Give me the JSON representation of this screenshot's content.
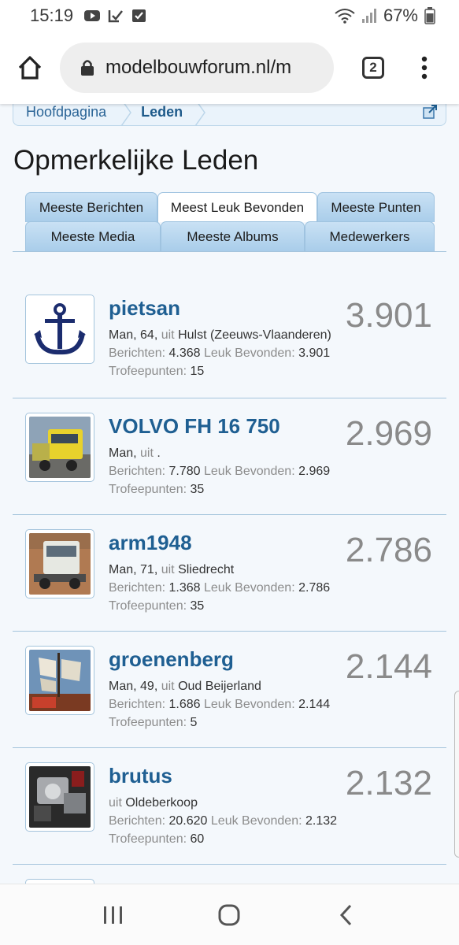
{
  "status": {
    "time": "15:19",
    "battery": "67%",
    "icons_left": [
      "youtube-icon",
      "check-icon",
      "checkbox-icon"
    ],
    "icons_right": [
      "wifi-icon",
      "signal-icon",
      "battery-icon"
    ]
  },
  "browser": {
    "url": "modelbouwforum.nl/m",
    "tab_count": "2"
  },
  "breadcrumb": {
    "home": "Hoofdpagina",
    "current": "Leden"
  },
  "page": {
    "title": "Opmerkelijke Leden"
  },
  "tabs": {
    "row1": [
      "Meeste Berichten",
      "Meest Leuk Bevonden",
      "Meeste Punten"
    ],
    "row2": [
      "Meeste Media",
      "Meeste Albums",
      "Medewerkers"
    ],
    "active": "Meest Leuk Bevonden"
  },
  "labels": {
    "uit": "uit",
    "berichten": "Berichten:",
    "leuk": "Leuk Bevonden:",
    "trofee": "Trofeepunten:"
  },
  "members": [
    {
      "name": "pietsan",
      "score": "3.901",
      "demo": "Man, 64,",
      "location": "Hulst (Zeeuws-Vlaanderen)",
      "berichten": "4.368",
      "leuk": "3.901",
      "trofee": "15",
      "avatar": "anchor-icon"
    },
    {
      "name": "VOLVO FH 16 750",
      "score": "2.969",
      "demo": "Man,",
      "location": ".",
      "berichten": "7.780",
      "leuk": "2.969",
      "trofee": "35",
      "avatar": "truck-photo"
    },
    {
      "name": "arm1948",
      "score": "2.786",
      "demo": "Man, 71,",
      "location": "Sliedrecht",
      "berichten": "1.368",
      "leuk": "2.786",
      "trofee": "35",
      "avatar": "truck-photo"
    },
    {
      "name": "groenenberg",
      "score": "2.144",
      "demo": "Man, 49,",
      "location": "Oud Beijerland",
      "berichten": "1.686",
      "leuk": "2.144",
      "trofee": "5",
      "avatar": "sailing-ship-photo"
    },
    {
      "name": "brutus",
      "score": "2.132",
      "demo": "",
      "location": "Oldeberkoop",
      "berichten": "20.620",
      "leuk": "2.132",
      "trofee": "60",
      "avatar": "engine-photo"
    }
  ],
  "colors": {
    "link": "#1f5f92",
    "tab_gradient_top": "#c9e1f4",
    "tab_gradient_bottom": "#a9cdea",
    "border": "#a4c4dc",
    "score": "#8a8a8a"
  }
}
